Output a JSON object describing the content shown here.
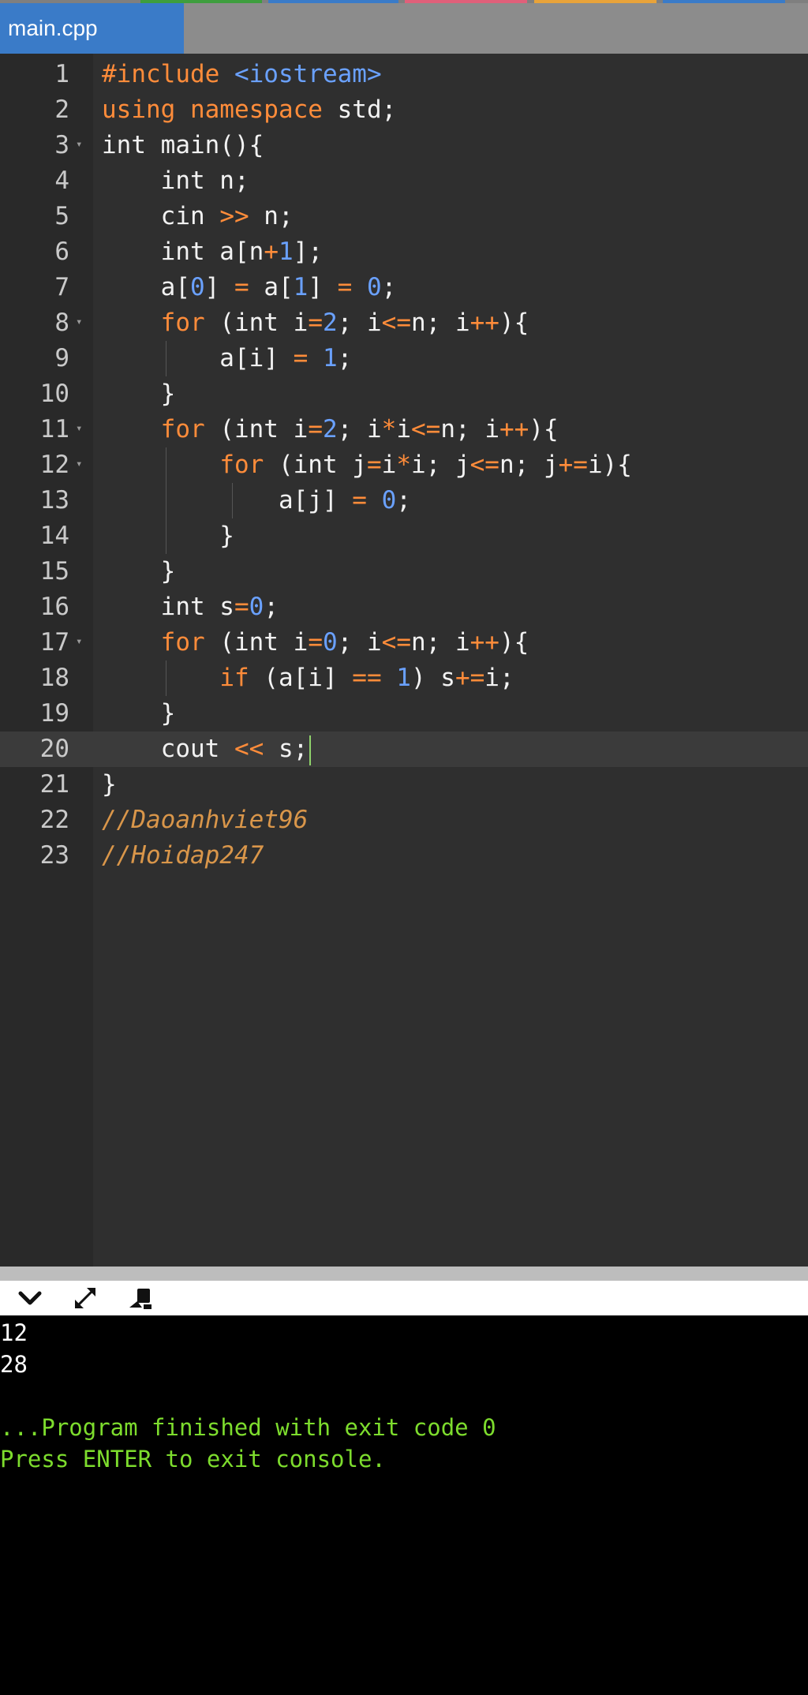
{
  "tab": {
    "filename": "main.cpp"
  },
  "colors": {
    "tab_active": "#3a7bc8",
    "editor_bg": "#2f2f2f",
    "keyword": "#ff8c3a",
    "number": "#6aa1ff",
    "console_success": "#7ddc2d"
  },
  "editor": {
    "lines": [
      {
        "num": "1",
        "text": "#include <iostream>"
      },
      {
        "num": "2",
        "text": "using namespace std;"
      },
      {
        "num": "3",
        "text": "int main(){"
      },
      {
        "num": "4",
        "text": "    int n;"
      },
      {
        "num": "5",
        "text": "    cin >> n;"
      },
      {
        "num": "6",
        "text": "    int a[n+1];"
      },
      {
        "num": "7",
        "text": "    a[0] = a[1] = 0;"
      },
      {
        "num": "8",
        "text": "    for (int i=2; i<=n; i++){"
      },
      {
        "num": "9",
        "text": "        a[i] = 1;"
      },
      {
        "num": "10",
        "text": "    }"
      },
      {
        "num": "11",
        "text": "    for (int i=2; i*i<=n; i++){"
      },
      {
        "num": "12",
        "text": "        for (int j=i*i; j<=n; j+=i){"
      },
      {
        "num": "13",
        "text": "            a[j] = 0;"
      },
      {
        "num": "14",
        "text": "        }"
      },
      {
        "num": "15",
        "text": "    }"
      },
      {
        "num": "16",
        "text": "    int s=0;"
      },
      {
        "num": "17",
        "text": "    for (int i=0; i<=n; i++){"
      },
      {
        "num": "18",
        "text": "        if (a[i] == 1) s+=i;"
      },
      {
        "num": "19",
        "text": "    }"
      },
      {
        "num": "20",
        "text": "    cout << s;"
      },
      {
        "num": "21",
        "text": "}"
      },
      {
        "num": "22",
        "text": "//Daoanhviet96"
      },
      {
        "num": "23",
        "text": "//Hoidap247"
      }
    ]
  },
  "console": {
    "toolbar_icons": [
      "chevron-down-icon",
      "expand-icon",
      "stop-icon"
    ],
    "output": [
      "12",
      "28"
    ],
    "finished_message": "...Program finished with exit code 0",
    "exit_prompt": "Press ENTER to exit console."
  }
}
